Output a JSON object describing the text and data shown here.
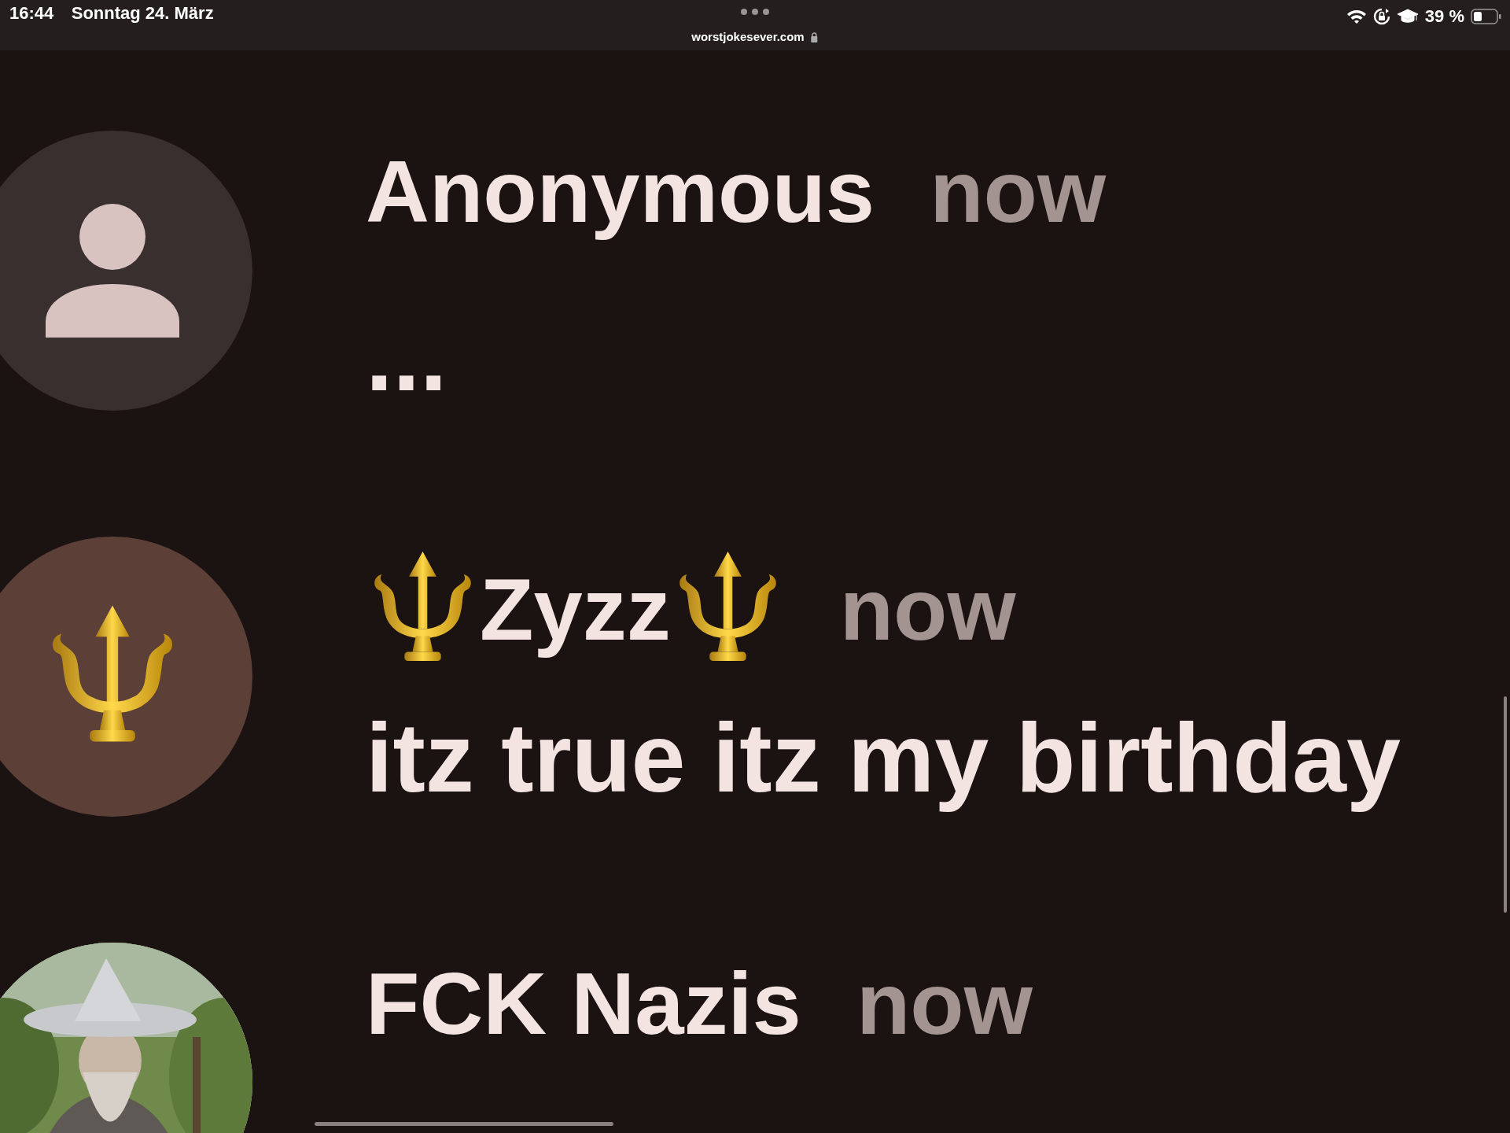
{
  "status_bar": {
    "time": "16:44",
    "date": "Sonntag 24. März",
    "url": "worstjokesever.com",
    "battery": "39 %"
  },
  "posts": [
    {
      "author": "Anonymous",
      "time": "now",
      "message": "...",
      "avatar": {
        "kind": "default",
        "color": "#3a2f2f"
      }
    },
    {
      "author": "Zyzz",
      "time": "now",
      "message": "itz true itz my birthday",
      "trident_decoration": true,
      "avatar": {
        "kind": "emoji",
        "color": "#5c3f36"
      }
    },
    {
      "author": "FCK Nazis",
      "time": "now"
    }
  ]
}
